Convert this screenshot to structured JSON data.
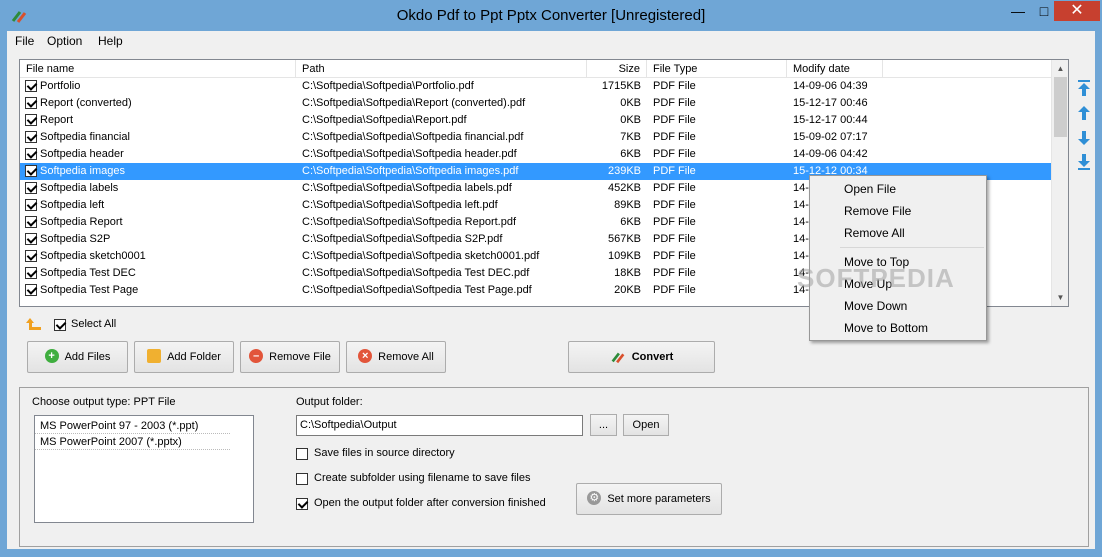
{
  "window": {
    "title": "Okdo Pdf to Ppt Pptx Converter [Unregistered]"
  },
  "menu": [
    "File",
    "Option",
    "Help"
  ],
  "columns": [
    "File name",
    "Path",
    "Size",
    "File Type",
    "Modify date"
  ],
  "files": [
    {
      "name": "Portfolio",
      "path": "C:\\Softpedia\\Softpedia\\Portfolio.pdf",
      "size": "1715KB",
      "type": "PDF File",
      "date": "14-09-06 04:39",
      "checked": true
    },
    {
      "name": "Report (converted)",
      "path": "C:\\Softpedia\\Softpedia\\Report (converted).pdf",
      "size": "0KB",
      "type": "PDF File",
      "date": "15-12-17 00:46",
      "checked": true
    },
    {
      "name": "Report",
      "path": "C:\\Softpedia\\Softpedia\\Report.pdf",
      "size": "0KB",
      "type": "PDF File",
      "date": "15-12-17 00:44",
      "checked": true
    },
    {
      "name": "Softpedia financial",
      "path": "C:\\Softpedia\\Softpedia\\Softpedia financial.pdf",
      "size": "7KB",
      "type": "PDF File",
      "date": "15-09-02 07:17",
      "checked": true
    },
    {
      "name": "Softpedia header",
      "path": "C:\\Softpedia\\Softpedia\\Softpedia header.pdf",
      "size": "6KB",
      "type": "PDF File",
      "date": "14-09-06 04:42",
      "checked": true
    },
    {
      "name": "Softpedia images",
      "path": "C:\\Softpedia\\Softpedia\\Softpedia images.pdf",
      "size": "239KB",
      "type": "PDF File",
      "date": "15-12-12 00:34",
      "checked": true,
      "selected": true
    },
    {
      "name": "Softpedia labels",
      "path": "C:\\Softpedia\\Softpedia\\Softpedia labels.pdf",
      "size": "452KB",
      "type": "PDF File",
      "date": "14-",
      "checked": true
    },
    {
      "name": "Softpedia left",
      "path": "C:\\Softpedia\\Softpedia\\Softpedia left.pdf",
      "size": "89KB",
      "type": "PDF File",
      "date": "14-",
      "checked": true
    },
    {
      "name": "Softpedia Report",
      "path": "C:\\Softpedia\\Softpedia\\Softpedia Report.pdf",
      "size": "6KB",
      "type": "PDF File",
      "date": "14-",
      "checked": true
    },
    {
      "name": "Softpedia S2P",
      "path": "C:\\Softpedia\\Softpedia\\Softpedia S2P.pdf",
      "size": "567KB",
      "type": "PDF File",
      "date": "14-",
      "checked": true
    },
    {
      "name": "Softpedia sketch0001",
      "path": "C:\\Softpedia\\Softpedia\\Softpedia sketch0001.pdf",
      "size": "109KB",
      "type": "PDF File",
      "date": "14-",
      "checked": true
    },
    {
      "name": "Softpedia Test DEC",
      "path": "C:\\Softpedia\\Softpedia\\Softpedia Test DEC.pdf",
      "size": "18KB",
      "type": "PDF File",
      "date": "14-",
      "checked": true
    },
    {
      "name": "Softpedia Test Page",
      "path": "C:\\Softpedia\\Softpedia\\Softpedia Test Page.pdf",
      "size": "20KB",
      "type": "PDF File",
      "date": "14-",
      "checked": true
    }
  ],
  "context_menu": [
    "Open File",
    "Remove File",
    "Remove All",
    "Move to Top",
    "Move Up",
    "Move Down",
    "Move to Bottom"
  ],
  "select_all_label": "Select All",
  "buttons": {
    "add_files": "Add Files",
    "add_folder": "Add Folder",
    "remove_file": "Remove File",
    "remove_all": "Remove All",
    "convert": "Convert"
  },
  "output": {
    "type_label": "Choose output type:  PPT File",
    "types": [
      "MS PowerPoint 97 - 2003 (*.ppt)",
      "MS PowerPoint 2007 (*.pptx)"
    ],
    "folder_label": "Output folder:",
    "folder_value": "C:\\Softpedia\\Output",
    "browse_label": "...",
    "open_label": "Open",
    "opt_source_dir": "Save files in source directory",
    "opt_subfolder": "Create subfolder using filename to save files",
    "opt_open_after": "Open the output folder after conversion finished",
    "more_params": "Set more parameters"
  },
  "watermark": "SOFTPEDIA",
  "colors": {
    "selection": "#3399ff",
    "titlebar": "#6fa6d6",
    "close": "#c7402f"
  }
}
